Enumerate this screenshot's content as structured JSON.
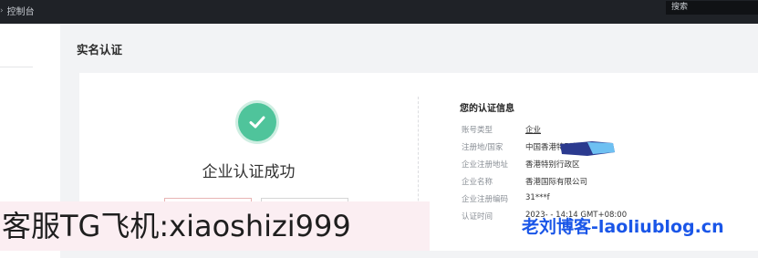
{
  "topbar": {
    "nav_label": "控制台",
    "search_placeholder": "搜索"
  },
  "page": {
    "title": "实名认证"
  },
  "status": {
    "text": "企业认证成功"
  },
  "info": {
    "title": "您的认证信息",
    "rows": [
      {
        "label": "账号类型",
        "value": "企业"
      },
      {
        "label": "注册地/国家",
        "value": "中国香港特别行政区"
      },
      {
        "label": "企业注册地址",
        "value": "香港特别行政区"
      },
      {
        "label": "企业名称",
        "value": "香港国际有限公司"
      },
      {
        "label": "企业注册编码",
        "value": "31***f"
      },
      {
        "label": "认证时间",
        "value": "2023-  -   14:14 GMT+08:00"
      }
    ]
  },
  "watermarks": {
    "left": "客服TG飞机:xiaoshizi999",
    "right": "老刘博客-laoliublog.cn"
  },
  "colors": {
    "topbar": "#1f2227",
    "success": "#4fc49b",
    "watermark_right": "#1a56e8",
    "redaction": "#6ec0f2"
  }
}
